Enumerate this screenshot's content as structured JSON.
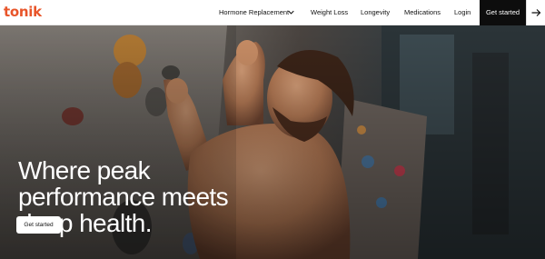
{
  "brand": {
    "logo": "tonik",
    "color": "#e8552a"
  },
  "nav": {
    "items": [
      {
        "label": "Hormone Replacement",
        "has_dropdown": true
      },
      {
        "label": "Weight Loss"
      },
      {
        "label": "Longevity"
      },
      {
        "label": "Medications"
      },
      {
        "label": "Login"
      }
    ],
    "cta": "Get started",
    "arrow_icon": "arrow-right-icon"
  },
  "hero": {
    "headline": "Where peak performance meets deep health.",
    "button": "Get started",
    "image": "man-rock-climbing"
  }
}
